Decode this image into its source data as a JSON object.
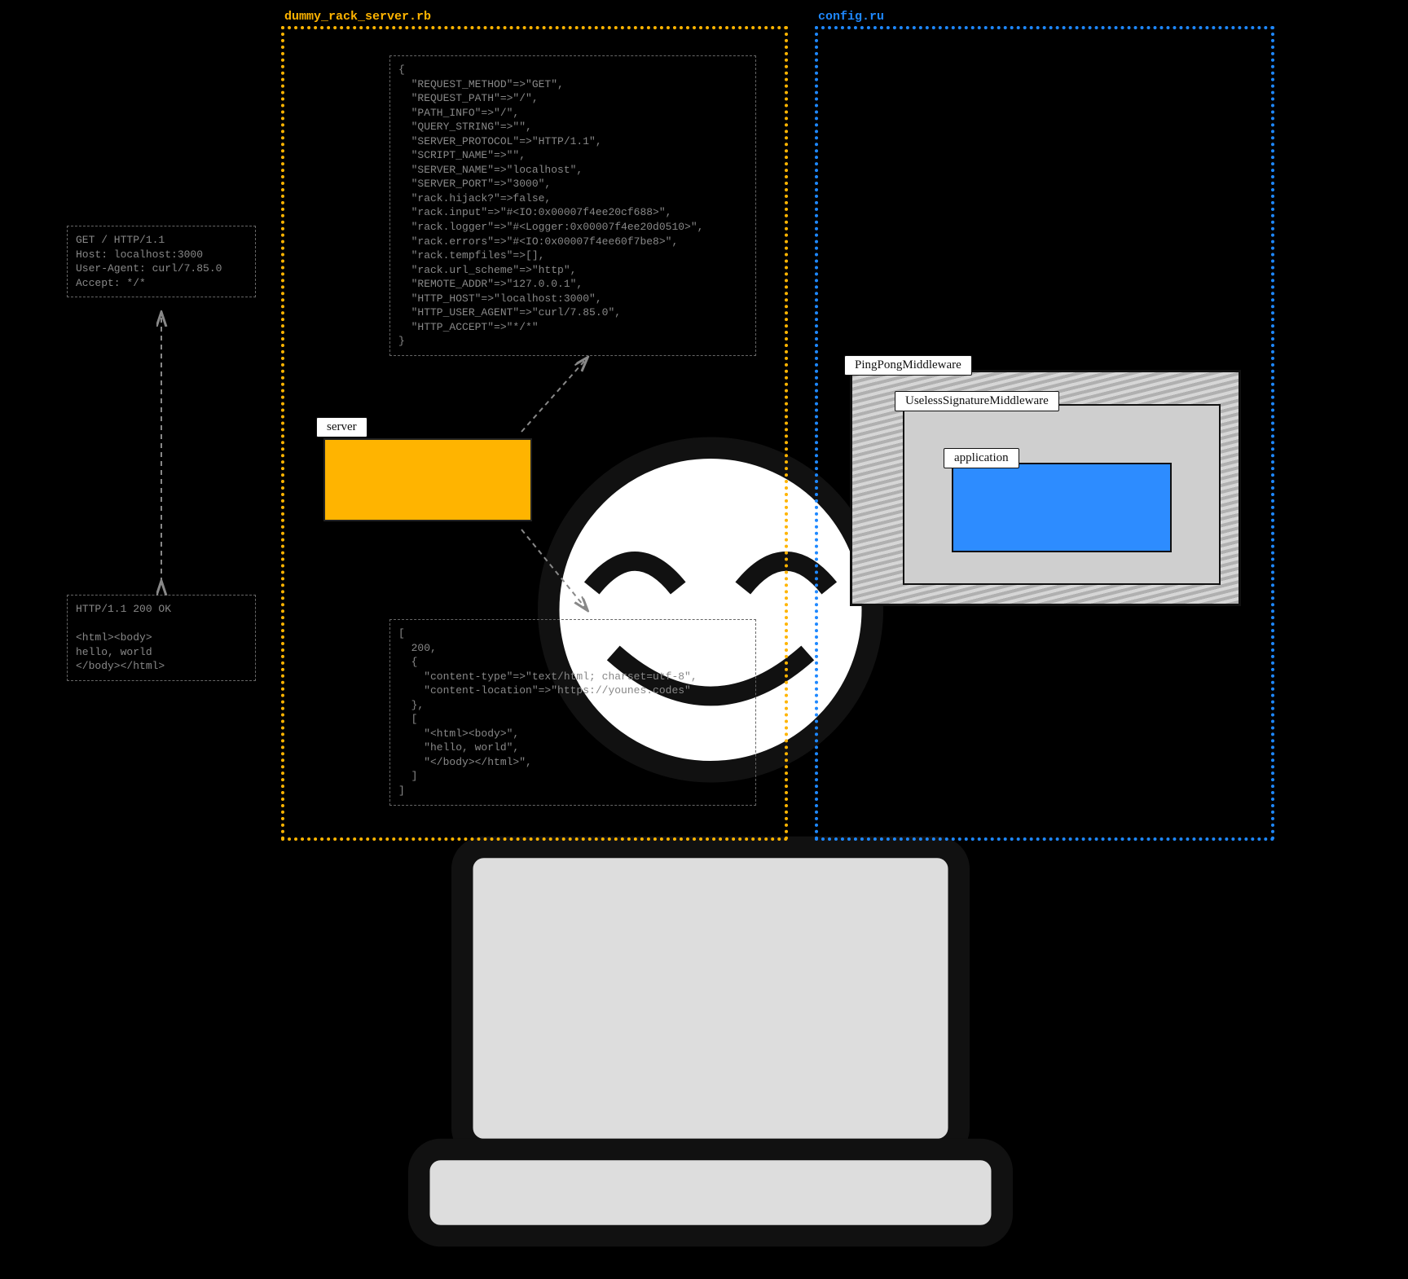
{
  "files": {
    "server_file": "dummy_rack_server.rb",
    "config_file": "config.ru"
  },
  "http_request": "GET / HTTP/1.1\nHost: localhost:3000\nUser-Agent: curl/7.85.0\nAccept: */*",
  "http_response": "HTTP/1.1 200 OK\n\n<html><body>\nhello, world\n</body></html>",
  "server_label": "server",
  "env_hash": "{\n  \"REQUEST_METHOD\"=>\"GET\",\n  \"REQUEST_PATH\"=>\"/\",\n  \"PATH_INFO\"=>\"/\",\n  \"QUERY_STRING\"=>\"\",\n  \"SERVER_PROTOCOL\"=>\"HTTP/1.1\",\n  \"SCRIPT_NAME\"=>\"\",\n  \"SERVER_NAME\"=>\"localhost\",\n  \"SERVER_PORT\"=>\"3000\",\n  \"rack.hijack?\"=>false,\n  \"rack.input\"=>\"#<IO:0x00007f4ee20cf688>\",\n  \"rack.logger\"=>\"#<Logger:0x00007f4ee20d0510>\",\n  \"rack.errors\"=>\"#<IO:0x00007f4ee60f7be8>\",\n  \"rack.tempfiles\"=>[],\n  \"rack.url_scheme\"=>\"http\",\n  \"REMOTE_ADDR\"=>\"127.0.0.1\",\n  \"HTTP_HOST\"=>\"localhost:3000\",\n  \"HTTP_USER_AGENT\"=>\"curl/7.85.0\",\n  \"HTTP_ACCEPT\"=>\"*/*\"\n}",
  "response_array": "[\n  200,\n  {\n    \"content-type\"=>\"text/html; charset=utf-8\",\n    \"content-location\"=>\"https://younes.codes\"\n  },\n  [\n    \"<html><body>\",\n    \"hello, world\",\n    \"</body></html>\",\n  ]\n]",
  "middleware": {
    "pingpong": "PingPongMiddleware",
    "useless": "UselessSignatureMiddleware",
    "app": "application"
  }
}
